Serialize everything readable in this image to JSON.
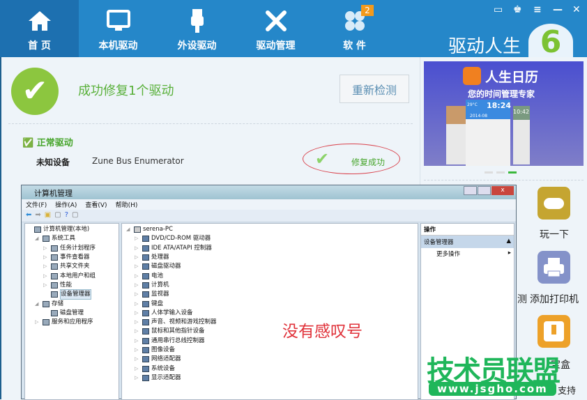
{
  "header": {
    "tabs": [
      {
        "label": "首 页",
        "icon": "home-icon",
        "active": true
      },
      {
        "label": "本机驱动",
        "icon": "monitor-icon"
      },
      {
        "label": "外设驱动",
        "icon": "usb-icon"
      },
      {
        "label": "驱动管理",
        "icon": "tools-icon"
      },
      {
        "label": "软 件",
        "icon": "clover-icon",
        "badge": "2"
      }
    ],
    "brand": "驱动人生",
    "brand_logo": "6",
    "window_controls": [
      "chat-icon",
      "skin-icon",
      "menu-icon",
      "minimize-icon",
      "close-icon"
    ]
  },
  "status": {
    "title": "成功修复1个驱动",
    "recheck_button": "重新检测"
  },
  "drivers": {
    "section": "正常驱动",
    "items": [
      {
        "category": "未知设备",
        "name": "Zune Bus Enumerator",
        "result": "修复成功"
      }
    ]
  },
  "ad": {
    "title": "人生日历",
    "subtitle": "您的时间管理专家",
    "time": "18:24",
    "time2": "10:42",
    "temp": "29°C",
    "date": "2014-08",
    "slide_index": 3,
    "slides": 3
  },
  "right_tools": [
    {
      "label": "玩一下",
      "icon": "gamepad-icon",
      "color": "#c5a531"
    },
    {
      "label": "添加打印机",
      "icon": "printer-icon",
      "color": "#8492c9"
    },
    {
      "label": "宝盒",
      "icon": "usb-box-icon",
      "color": "#eda129"
    }
  ],
  "right_bottom": "支持",
  "hidden_left_label": "测",
  "devmgr": {
    "title": "计算机管理",
    "menu": [
      "文件(F)",
      "操作(A)",
      "查看(V)",
      "帮助(H)"
    ],
    "tree": [
      {
        "label": "计算机管理(本地)",
        "level": 0
      },
      {
        "label": "系统工具",
        "level": 1
      },
      {
        "label": "任务计划程序",
        "level": 2
      },
      {
        "label": "事件查看器",
        "level": 2
      },
      {
        "label": "共享文件夹",
        "level": 2
      },
      {
        "label": "本地用户和组",
        "level": 2
      },
      {
        "label": "性能",
        "level": 2
      },
      {
        "label": "设备管理器",
        "level": 2,
        "selected": true
      },
      {
        "label": "存储",
        "level": 1
      },
      {
        "label": "磁盘管理",
        "level": 2
      },
      {
        "label": "服务和应用程序",
        "level": 1
      }
    ],
    "root": "serena-PC",
    "devices": [
      "DVD/CD-ROM 驱动器",
      "IDE ATA/ATAPI 控制器",
      "处理器",
      "磁盘驱动器",
      "电池",
      "计算机",
      "监视器",
      "键盘",
      "人体学输入设备",
      "声音、视频和游戏控制器",
      "鼠标和其他指针设备",
      "通用串行总线控制器",
      "图像设备",
      "网络适配器",
      "系统设备",
      "显示适配器"
    ],
    "actions": {
      "header": "操作",
      "section": "设备管理器",
      "more": "更多操作"
    }
  },
  "annotation": "没有感叹号",
  "watermark": {
    "title": "技术员联盟",
    "url": "www.jsgho.com",
    "color": "#1fb65a"
  }
}
